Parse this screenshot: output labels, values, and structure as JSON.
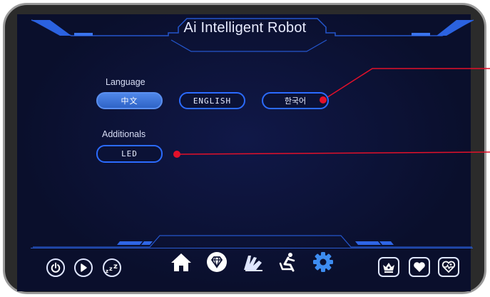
{
  "header": {
    "title": "Ai Intelligent Robot"
  },
  "language": {
    "label": "Language",
    "options": [
      "中文",
      "ENGLISH",
      "한국어"
    ],
    "selected": "中文"
  },
  "additionals": {
    "label": "Additionals",
    "led_label": "LED"
  },
  "icons": {
    "power": "power-icon",
    "play": "play-icon",
    "sleep": "sleep-icon",
    "home": "home-icon",
    "diamond": "diamond-icon",
    "recline": "recline-icon",
    "seat": "seat-icon",
    "settings": "gear-icon",
    "crown": "crown-icon",
    "heart": "heart-icon",
    "health": "heart-health-icon"
  },
  "colors": {
    "accent": "#2b6bff",
    "active_button": "#3a74d8",
    "callout": "#e3102a",
    "settings_icon": "#3d8cf0"
  }
}
